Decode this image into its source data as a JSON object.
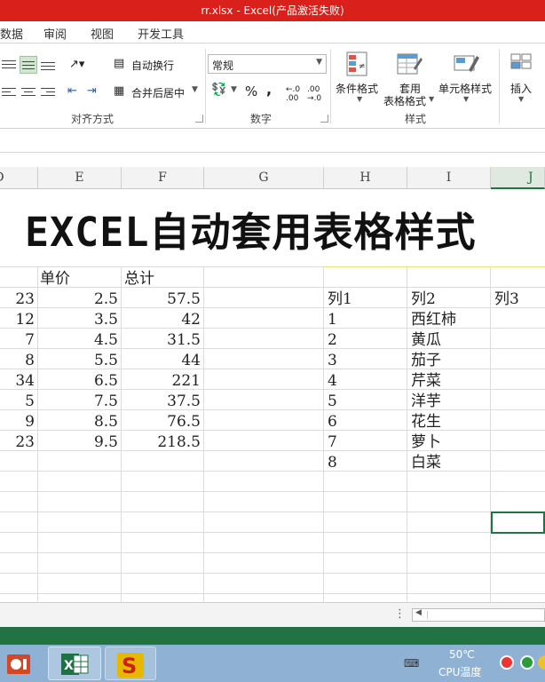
{
  "window": {
    "title": "rr.xlsx -  Excel(产品激活失败)"
  },
  "tabs": [
    {
      "label": "数据"
    },
    {
      "label": "审阅"
    },
    {
      "label": "视图"
    },
    {
      "label": "开发工具"
    }
  ],
  "ribbon": {
    "alignment": {
      "group_label": "对齐方式",
      "wrap_text": "自动换行",
      "merge_center": "合并后居中"
    },
    "number": {
      "group_label": "数字",
      "format_value": "常规",
      "percent": "%",
      "comma": ",",
      "inc_decimal": ".00→.0",
      "dec_decimal": ".00←.0"
    },
    "styles": {
      "group_label": "样式",
      "conditional": "条件格式",
      "format_table_1": "套用",
      "format_table_2": "表格格式",
      "cell_styles": "单元格样式"
    },
    "cells": {
      "insert": "插入"
    }
  },
  "columns": [
    {
      "label": "D"
    },
    {
      "label": "E"
    },
    {
      "label": "F"
    },
    {
      "label": "G"
    },
    {
      "label": "H"
    },
    {
      "label": "I"
    },
    {
      "label": "J"
    }
  ],
  "sheet": {
    "title": "EXCEL自动套用表格样式",
    "left_headers": {
      "price": "单价",
      "total": "总计"
    },
    "left_rows": [
      {
        "qty": "23",
        "price": "2.5",
        "total": "57.5"
      },
      {
        "qty": "12",
        "price": "3.5",
        "total": "42"
      },
      {
        "qty": "7",
        "price": "4.5",
        "total": "31.5"
      },
      {
        "qty": "8",
        "price": "5.5",
        "total": "44"
      },
      {
        "qty": "34",
        "price": "6.5",
        "total": "221"
      },
      {
        "qty": "5",
        "price": "7.5",
        "total": "37.5"
      },
      {
        "qty": "9",
        "price": "8.5",
        "total": "76.5"
      },
      {
        "qty": "23",
        "price": "9.5",
        "total": "218.5"
      }
    ],
    "table_headers": {
      "col1": "列1",
      "col2": "列2",
      "col3": "列3"
    },
    "table_rows": [
      {
        "id": "1",
        "name": "西红柿"
      },
      {
        "id": "2",
        "name": "黄瓜"
      },
      {
        "id": "3",
        "name": "茄子"
      },
      {
        "id": "4",
        "name": "芹菜"
      },
      {
        "id": "5",
        "name": "洋芋"
      },
      {
        "id": "6",
        "name": "花生"
      },
      {
        "id": "7",
        "name": "萝卜"
      },
      {
        "id": "8",
        "name": "白菜"
      }
    ]
  },
  "taskbar": {
    "temperature": "50℃",
    "cpu_label": "CPU温度",
    "apps": [
      "powerpoint-icon",
      "excel-icon",
      "sogou-icon"
    ]
  },
  "colors": {
    "titlebar": "#d9201a",
    "excel_green": "#217346",
    "taskbar": "#8fb2d4"
  }
}
